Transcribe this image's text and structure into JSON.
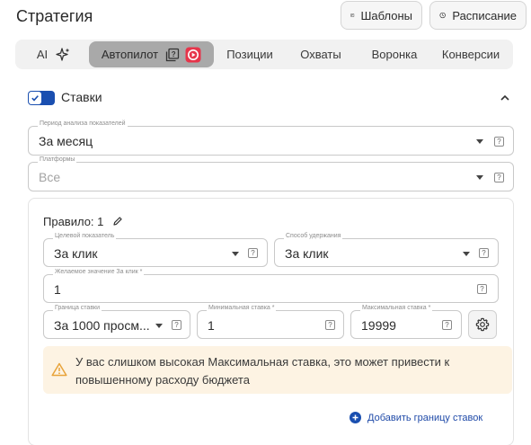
{
  "header": {
    "title": "Стратегия",
    "templates_label": "Шаблоны",
    "schedule_label": "Расписание"
  },
  "tabs": [
    {
      "label": "AI"
    },
    {
      "label": "Автопилот"
    },
    {
      "label": "Позиции"
    },
    {
      "label": "Охваты"
    },
    {
      "label": "Воронка"
    },
    {
      "label": "Конверсии"
    }
  ],
  "section": {
    "title": "Ставки",
    "enabled": true
  },
  "fields": {
    "period": {
      "label": "Период анализа показателей",
      "value": "За месяц"
    },
    "platforms": {
      "label": "Платформы",
      "placeholder": "Все"
    }
  },
  "rule": {
    "title": "Правило: 1",
    "target_metric": {
      "label": "Целевой показатель",
      "value": "За клик"
    },
    "hold_method": {
      "label": "Способ удержания",
      "value": "За клик"
    },
    "desired_value": {
      "label": "Желаемое значение За клик *",
      "value": "1"
    },
    "bid_limit": {
      "label": "Граница ставки",
      "value": "За 1000 просм..."
    },
    "min_bid": {
      "label": "Минимальная ставка *",
      "value": "1"
    },
    "max_bid": {
      "label": "Максимальная ставка *",
      "value": "19999"
    }
  },
  "alert": {
    "text": "У вас слишком высокая Максимальная ставка, это может привести к повышенному расходу бюджета"
  },
  "add_bid_limit_label": "Добавить границу ставок",
  "help_glyph": "?",
  "colors": {
    "accent": "#1a4fb0",
    "alert_bg": "#fdf3e3",
    "warning": "#e8a33a",
    "active_tab": "#a9a9a9"
  }
}
